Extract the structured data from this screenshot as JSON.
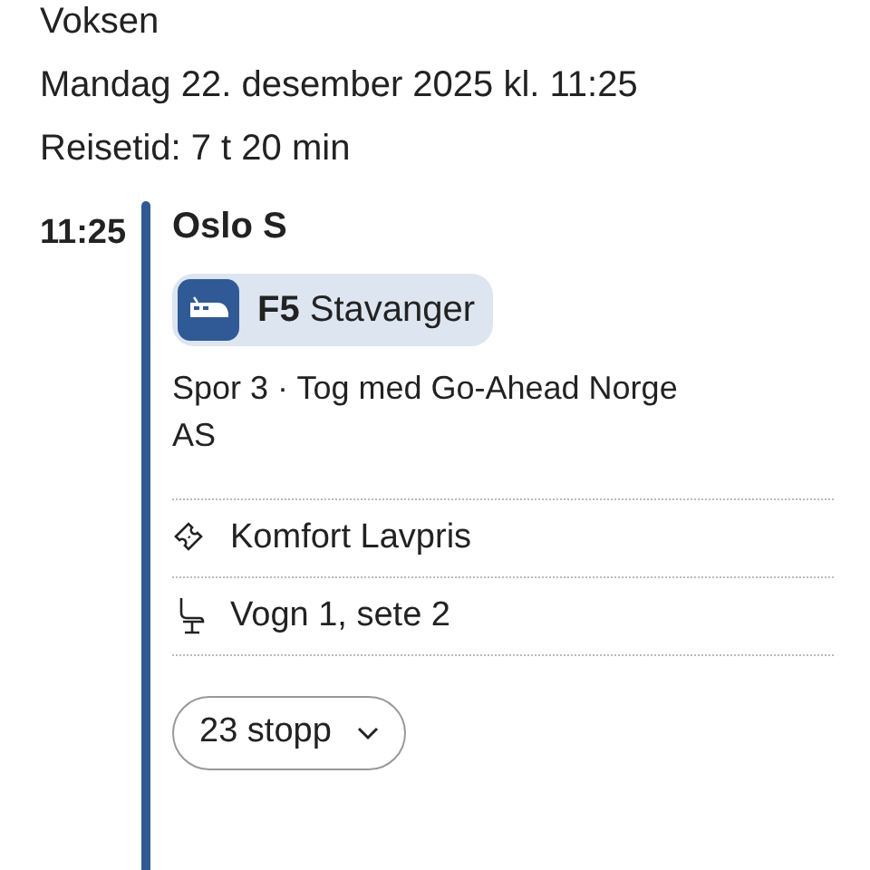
{
  "header": {
    "passenger": "Voksen",
    "date": "Mandag 22. desember 2025 kl. 11:25",
    "duration": "Reisetid: 7 t 20 min"
  },
  "leg": {
    "time": "11:25",
    "station": "Oslo S",
    "line": {
      "code": "F5",
      "destination": "Stavanger"
    },
    "details": "Spor 3 · Tog med Go-Ahead Norge AS",
    "info": [
      {
        "kind": "ticket",
        "text": "Komfort Lavpris"
      },
      {
        "kind": "seat",
        "text": "Vogn 1, sete 2"
      }
    ],
    "stops_button": {
      "label": "23 stopp",
      "expanded": false
    }
  }
}
